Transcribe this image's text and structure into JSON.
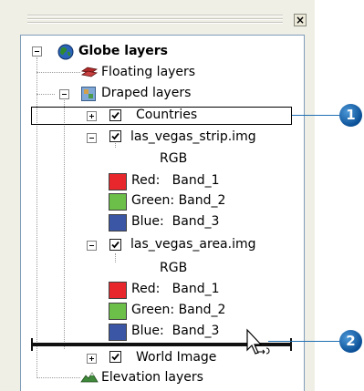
{
  "window": {
    "close_glyph": "×"
  },
  "tree": {
    "root": {
      "label": "Globe layers",
      "expander": "minus",
      "icon": "globe-icon"
    },
    "floating": {
      "label": "Floating layers",
      "icon": "floating-layers-icon"
    },
    "draped": {
      "label": "Draped layers",
      "expander": "minus",
      "icon": "draped-layers-icon"
    },
    "countries": {
      "label": "Countries",
      "expander": "plus",
      "checked": true
    },
    "strip": {
      "label": "las_vegas_strip.img",
      "expander": "minus",
      "checked": true,
      "renderer": "RGB",
      "bands": [
        {
          "label": "Red:   Band_1",
          "color": "#e8272c"
        },
        {
          "label": "Green: Band_2",
          "color": "#6cc04a"
        },
        {
          "label": "Blue:  Band_3",
          "color": "#3a56a5"
        }
      ]
    },
    "area": {
      "label": "las_vegas_area.img",
      "expander": "minus",
      "checked": true,
      "renderer": "RGB",
      "bands": [
        {
          "label": "Red:   Band_1",
          "color": "#e8272c"
        },
        {
          "label": "Green: Band_2",
          "color": "#6cc04a"
        },
        {
          "label": "Blue:  Band_3",
          "color": "#3a56a5"
        }
      ]
    },
    "world": {
      "label": "World Image",
      "expander": "plus",
      "checked": true
    },
    "elevation": {
      "label": "Elevation layers",
      "icon": "elevation-layers-icon"
    }
  },
  "callouts": [
    {
      "number": "1"
    },
    {
      "number": "2"
    }
  ],
  "colors": {
    "callout": "#1a6bb8",
    "selection_border": "#000000"
  }
}
